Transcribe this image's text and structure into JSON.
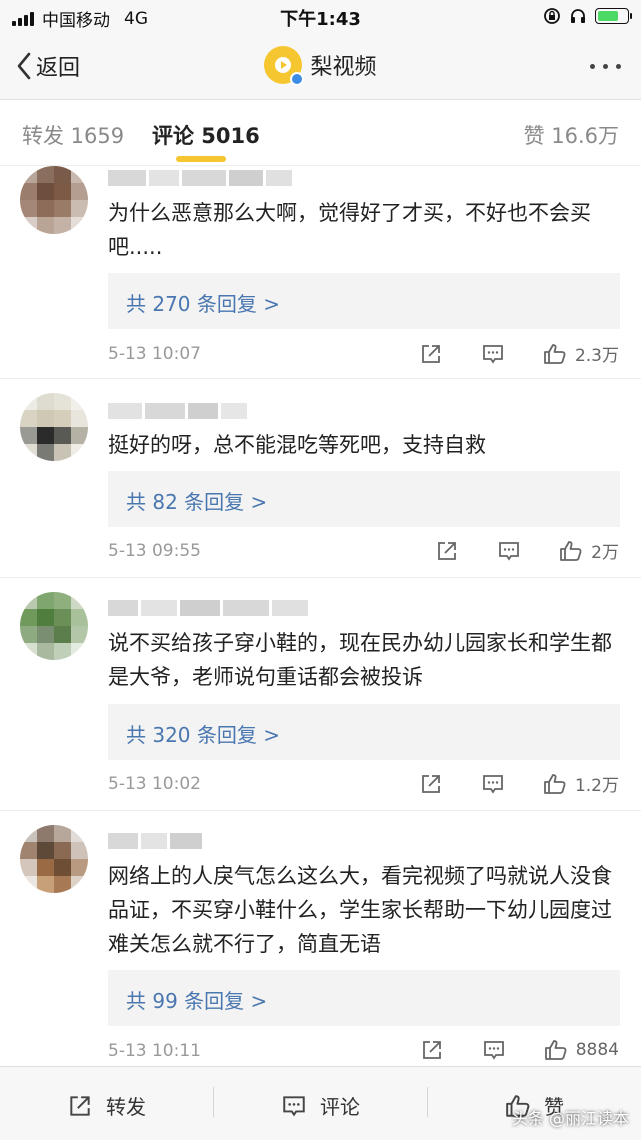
{
  "status_bar": {
    "carrier": "中国移动",
    "network": "4G",
    "time": "下午1:43"
  },
  "nav": {
    "back_label": "返回",
    "title": "梨视频",
    "more_icon": "more-icon"
  },
  "tabs": {
    "repost": "转发 1659",
    "comment": "评论 5016",
    "like": "赞 16.6万"
  },
  "comments": [
    {
      "text": "为什么恶意那么大啊，觉得好了才买，不好也不会买吧.....",
      "replies": "共 270 条回复 >",
      "time": "5-13 10:07",
      "likes": "2.3万"
    },
    {
      "text": "挺好的呀，总不能混吃等死吧，支持自救",
      "replies": "共 82 条回复 >",
      "time": "5-13 09:55",
      "likes": "2万"
    },
    {
      "text": "说不买给孩子穿小鞋的，现在民办幼儿园家长和学生都是大爷，老师说句重话都会被投诉",
      "replies": "共 320 条回复 >",
      "time": "5-13 10:02",
      "likes": "1.2万"
    },
    {
      "text": "网络上的人戾气怎么这么大，看完视频了吗就说人没食品证，不买穿小鞋什么，学生家长帮助一下幼儿园度过难关怎么就不行了，简直无语",
      "replies": "共 99 条回复 >",
      "time": "5-13 10:11",
      "likes": "8884"
    }
  ],
  "bottom_bar": {
    "repost": "转发",
    "comment": "评论",
    "like": "赞",
    "watermark": "头条 @丽江读本"
  },
  "colors": {
    "accent": "#f6c630",
    "link": "#4a77b0",
    "muted": "#999999"
  }
}
